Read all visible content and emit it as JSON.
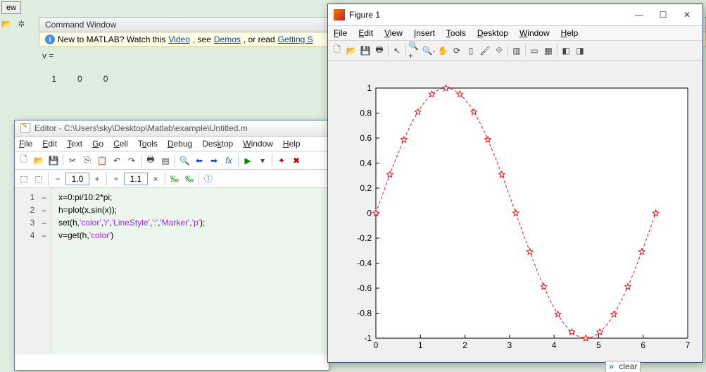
{
  "main_tab_label": "ew",
  "command_window": {
    "title": "Command Window",
    "welcome_prefix": " New to MATLAB? Watch this ",
    "link_video": "Video",
    "welcome_mid1": ", see ",
    "link_demos": "Demos",
    "welcome_mid2": ", or read ",
    "link_getting_started": "Getting S",
    "output_var": "v =",
    "output_vals": "    1         0         0"
  },
  "editor": {
    "title": "Editor - C:\\Users\\sky\\Desktop\\Matlab\\example\\Untitled.m",
    "menu": [
      "File",
      "Edit",
      "Text",
      "Go",
      "Cell",
      "Tools",
      "Debug",
      "Desktop",
      "Window",
      "Help"
    ],
    "zoom1": "1.0",
    "zoom2": "1.1",
    "code_lines": [
      {
        "n": "1",
        "dash": "–",
        "pre": "x=0:pi/10:2*pi;",
        "str": "",
        "post": ""
      },
      {
        "n": "2",
        "dash": "–",
        "pre": "h=plot(x,sin(x));",
        "str": "",
        "post": ""
      },
      {
        "n": "3",
        "dash": "–",
        "pre": "set(h,",
        "str": "'color','r','LineStyle',':','Marker','p'",
        "post": ");"
      },
      {
        "n": "4",
        "dash": "–",
        "pre": "v=get(h,",
        "str": "'color'",
        "post": ")"
      }
    ]
  },
  "figure": {
    "title": "Figure 1",
    "menu": [
      "File",
      "Edit",
      "View",
      "Insert",
      "Tools",
      "Desktop",
      "Window",
      "Help"
    ],
    "yticks": [
      "-1",
      "-0.8",
      "-0.6",
      "-0.4",
      "-0.2",
      "0",
      "0.2",
      "0.4",
      "0.6",
      "0.8",
      "1"
    ],
    "xticks": [
      "0",
      "1",
      "2",
      "3",
      "4",
      "5",
      "6",
      "7"
    ]
  },
  "chart_data": {
    "type": "line",
    "x": [
      0,
      0.3142,
      0.6283,
      0.9425,
      1.2566,
      1.5708,
      1.885,
      2.1991,
      2.5133,
      2.8274,
      3.1416,
      3.4558,
      3.7699,
      4.0841,
      4.3982,
      4.7124,
      5.0265,
      5.3407,
      5.6549,
      5.969,
      6.2832
    ],
    "values": [
      0,
      0.309,
      0.588,
      0.809,
      0.951,
      1.0,
      0.951,
      0.809,
      0.588,
      0.309,
      0.0,
      -0.309,
      -0.588,
      -0.809,
      -0.951,
      -1.0,
      -0.951,
      -0.809,
      -0.588,
      -0.309,
      0.0
    ],
    "xlim": [
      0,
      7
    ],
    "ylim": [
      -1,
      1
    ],
    "linestyle": ":",
    "marker": "p",
    "color": "#e11"
  },
  "bottom_cmd": "clear"
}
